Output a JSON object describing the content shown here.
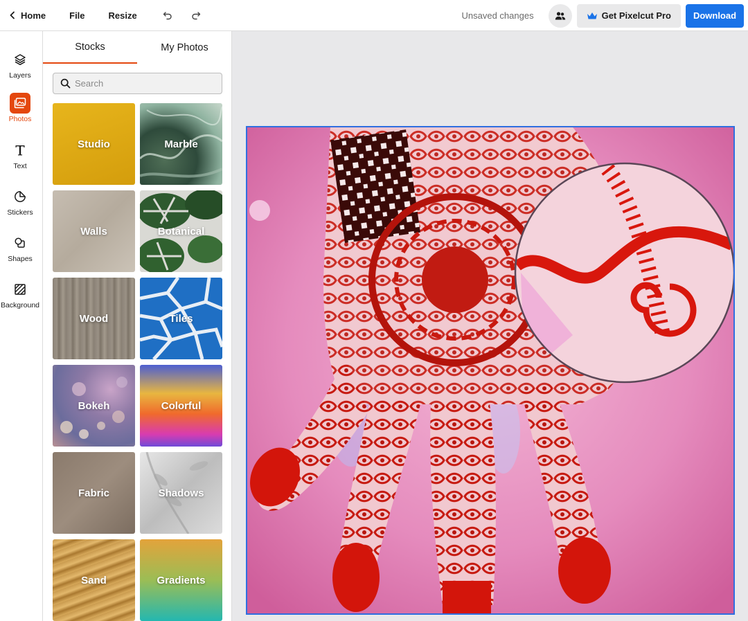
{
  "topbar": {
    "home_label": "Home",
    "file_label": "File",
    "resize_label": "Resize",
    "undo_icon": "undo-icon",
    "redo_icon": "redo-icon",
    "status_text": "Unsaved changes",
    "collab_icon": "people-icon",
    "pro_label": "Get Pixelcut Pro",
    "pro_icon": "crown-icon",
    "download_label": "Download",
    "accent_color": "#1a73e8"
  },
  "rail": {
    "active_color": "#e4470e",
    "items": [
      {
        "label": "Layers",
        "icon": "layers-icon"
      },
      {
        "label": "Photos",
        "icon": "photos-icon",
        "active": true
      },
      {
        "label": "Text",
        "icon": "text-icon"
      },
      {
        "label": "Stickers",
        "icon": "stickers-icon"
      },
      {
        "label": "Shapes",
        "icon": "shapes-icon"
      },
      {
        "label": "Background",
        "icon": "background-icon"
      }
    ]
  },
  "panel": {
    "tabs": [
      {
        "label": "Stocks",
        "active": true
      },
      {
        "label": "My Photos"
      }
    ],
    "search": {
      "placeholder": "Search",
      "value": ""
    },
    "tiles": [
      {
        "label": "Studio"
      },
      {
        "label": "Marble"
      },
      {
        "label": "Walls"
      },
      {
        "label": "Botanical"
      },
      {
        "label": "Wood"
      },
      {
        "label": "Tiles"
      },
      {
        "label": "Bokeh"
      },
      {
        "label": "Colorful"
      },
      {
        "label": "Fabric"
      },
      {
        "label": "Shadows"
      },
      {
        "label": "Sand"
      },
      {
        "label": "Gradients"
      }
    ]
  },
  "canvas": {
    "image": "henna-hand-photo",
    "selection_color": "#2f6ee0"
  }
}
